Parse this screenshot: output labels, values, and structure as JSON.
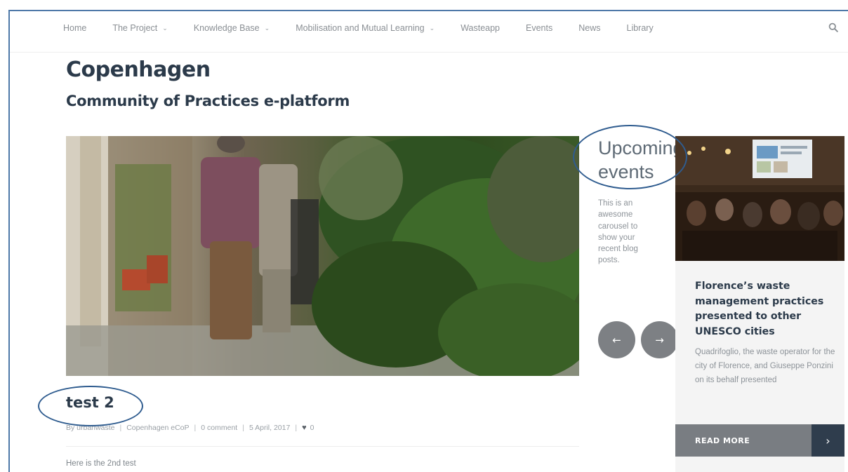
{
  "nav": {
    "items": [
      {
        "label": "Home",
        "has_dropdown": false
      },
      {
        "label": "The Project",
        "has_dropdown": true
      },
      {
        "label": "Knowledge Base",
        "has_dropdown": true
      },
      {
        "label": "Mobilisation and Mutual Learning",
        "has_dropdown": true
      },
      {
        "label": "Wasteapp",
        "has_dropdown": false
      },
      {
        "label": "Events",
        "has_dropdown": false
      },
      {
        "label": "News",
        "has_dropdown": false
      },
      {
        "label": "Library",
        "has_dropdown": false
      }
    ],
    "search_icon": "search-icon"
  },
  "page": {
    "title": "Copenhagen",
    "subtitle": "Community of Practices e-platform"
  },
  "post": {
    "title": "test 2",
    "author": "By urbanwaste",
    "category": "Copenhagen eCoP",
    "comments": "0 comment",
    "date": "5 April, 2017",
    "likes": "0",
    "separator": "|",
    "excerpt": "Here is the 2nd test"
  },
  "upcoming": {
    "title_line1": "Upcoming",
    "title_line2": "events",
    "description": "This is an awesome carousel to show your recent blog posts.",
    "prev_arrow": "←",
    "next_arrow": "→"
  },
  "event_card": {
    "title": "Florence’s waste management practices presented to other UNESCO cities",
    "text": "Quadrifoglio, the waste operator for the city of Florence, and Giuseppe Ponzini on its behalf presented",
    "read_more": "READ MORE",
    "read_more_arrow": "›"
  },
  "colors": {
    "accent_dark": "#2f3d4d",
    "button_gray": "#797d82",
    "annotation_blue": "#2f5c8f"
  }
}
